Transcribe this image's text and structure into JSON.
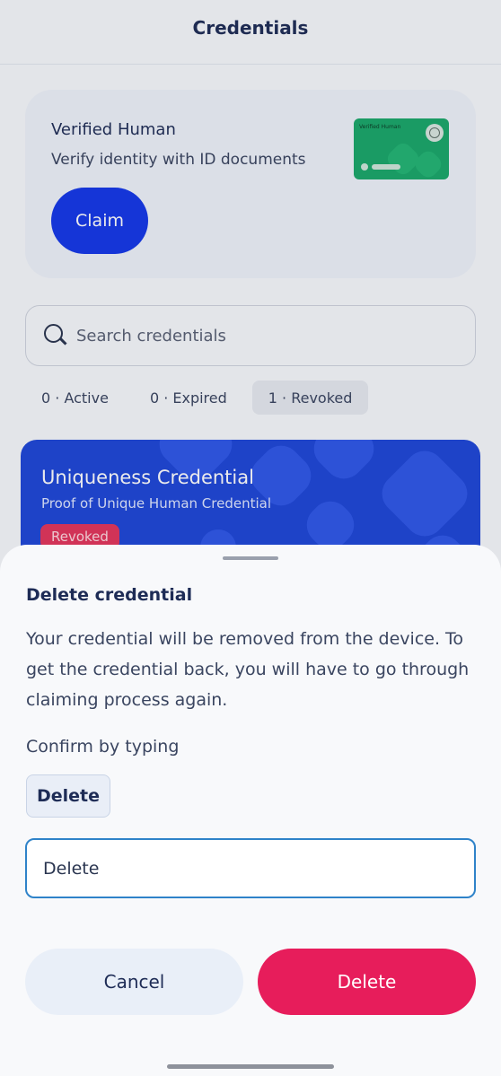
{
  "header": {
    "title": "Credentials"
  },
  "promo": {
    "title": "Verified Human",
    "subtitle": "Verify identity with ID documents",
    "claim_label": "Claim",
    "card_label": "Verified Human",
    "card_color": "#1aa86a"
  },
  "search": {
    "placeholder": "Search credentials",
    "icon": "search-icon"
  },
  "filters": [
    {
      "label": "0 · Active"
    },
    {
      "label": "0 · Expired"
    },
    {
      "label": "1 · Revoked",
      "selected": true
    }
  ],
  "credential": {
    "title": "Uniqueness Credential",
    "subtitle": "Proof of Unique Human Credential",
    "status": "Revoked",
    "card_color": "#1e47d8",
    "status_color": "#e3355c"
  },
  "sheet": {
    "title": "Delete credential",
    "body": "Your credential will be removed from the device. To get the credential back, you will have to go through claiming process again.",
    "confirm_label": "Confirm by typing",
    "confirm_word": "Delete",
    "input_value": "Delete",
    "cancel_label": "Cancel",
    "delete_label": "Delete",
    "delete_color": "#e71d5b"
  }
}
